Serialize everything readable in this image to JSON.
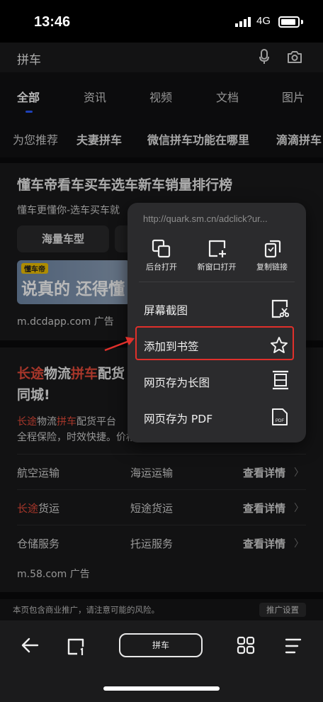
{
  "status_bar": {
    "time": "13:46",
    "network": "4G"
  },
  "search": {
    "query": "拼车"
  },
  "tabs": [
    {
      "label": "全部",
      "active": true
    },
    {
      "label": "资讯"
    },
    {
      "label": "视频"
    },
    {
      "label": "文档"
    },
    {
      "label": "图片"
    }
  ],
  "suggestions": [
    {
      "label": "为您推荐"
    },
    {
      "label": "夫妻拼车"
    },
    {
      "label": "微信拼车功能在哪里"
    },
    {
      "label": "滴滴拼车"
    }
  ],
  "card1": {
    "title": "懂车帝看车买车选车新车销量排行榜",
    "description": "懂车更懂你-选车买车就",
    "button1": "海量车型",
    "banner_logo": "懂车帝",
    "banner_text": "说真的 还得懂",
    "source": "m.dcdapp.com 广告"
  },
  "card2": {
    "title_parts": [
      "长途",
      "物流",
      "拼车",
      "配货",
      "同城!"
    ],
    "desc_parts": [
      "长途",
      "物流",
      "拼车",
      "配货平台",
      "全程保险，时效快捷。价格优惠。"
    ],
    "rows": [
      {
        "a": "航空运输",
        "b": "海运运输",
        "link": "查看详情"
      },
      {
        "a_hl": "长途",
        "a_rest": "货运",
        "b": "短途货运",
        "link": "查看详情"
      },
      {
        "a": "仓储服务",
        "b": "托运服务",
        "link": "查看详情"
      }
    ],
    "source": "m.58.com 广告"
  },
  "notice": {
    "text": "本页包含商业推广，请注意可能的风险。",
    "button": "推广设置"
  },
  "bottom_nav": {
    "search_label": "拼车"
  },
  "popup": {
    "url": "http://quark.sm.cn/adclick?ur...",
    "quick_actions": [
      {
        "label": "后台打开",
        "icon": "background-open-icon"
      },
      {
        "label": "新窗口打开",
        "icon": "new-window-icon"
      },
      {
        "label": "复制链接",
        "icon": "copy-link-icon"
      }
    ],
    "items": [
      {
        "label": "屏幕截图",
        "icon": "screenshot-icon"
      },
      {
        "label": "添加到书签",
        "icon": "star-icon",
        "highlighted": true
      },
      {
        "label": "网页存为长图",
        "icon": "long-image-icon"
      },
      {
        "label": "网页存为 PDF",
        "icon": "pdf-icon",
        "icon_text": "PDF"
      }
    ]
  },
  "colors": {
    "highlight_red": "#e0302b",
    "keyword_red": "#e64b3b",
    "tab_indicator": "#2a5bff"
  }
}
